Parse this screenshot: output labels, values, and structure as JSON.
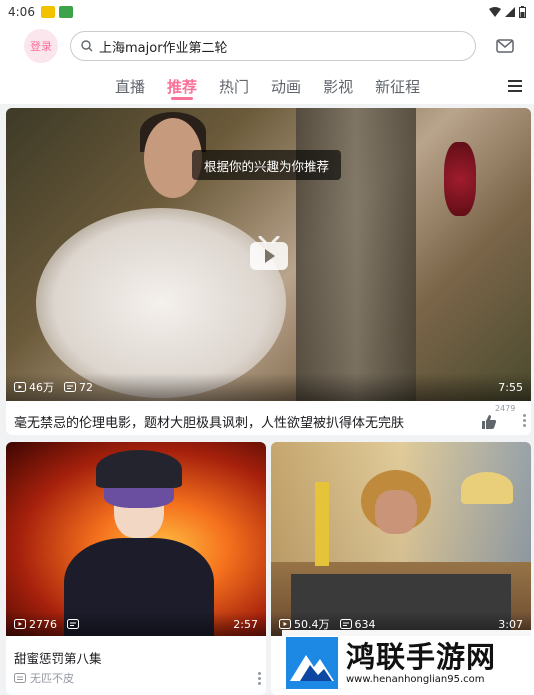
{
  "status_bar": {
    "time": "4:06"
  },
  "header": {
    "login_label": "登录",
    "search_text": "上海major作业第二轮"
  },
  "tabs": [
    {
      "label": "直播"
    },
    {
      "label": "推荐",
      "active": true
    },
    {
      "label": "热门"
    },
    {
      "label": "动画"
    },
    {
      "label": "影视"
    },
    {
      "label": "新征程"
    }
  ],
  "feature": {
    "tip": "根据你的兴趣为你推荐",
    "views": "46万",
    "danmaku": "72",
    "duration": "7:55",
    "title": "毫无禁忌的伦理电影，题材大胆极具讽刺，人性欲望被扒得体无完肤",
    "likes": "2479"
  },
  "cards": [
    {
      "views": "2776",
      "danmaku": "",
      "duration": "2:57",
      "title": "甜蜜惩罚第八集",
      "subtitle": "无匹不皮"
    },
    {
      "views": "50.4万",
      "danmaku": "634",
      "duration": "3:07",
      "title": "",
      "subtitle": ""
    }
  ],
  "watermark": {
    "name": "鸿联手游网",
    "url": "www.henanhonglian95.com"
  },
  "colors": {
    "accent": "#fb7299",
    "text": "#18191c",
    "muted": "#9499a0"
  }
}
